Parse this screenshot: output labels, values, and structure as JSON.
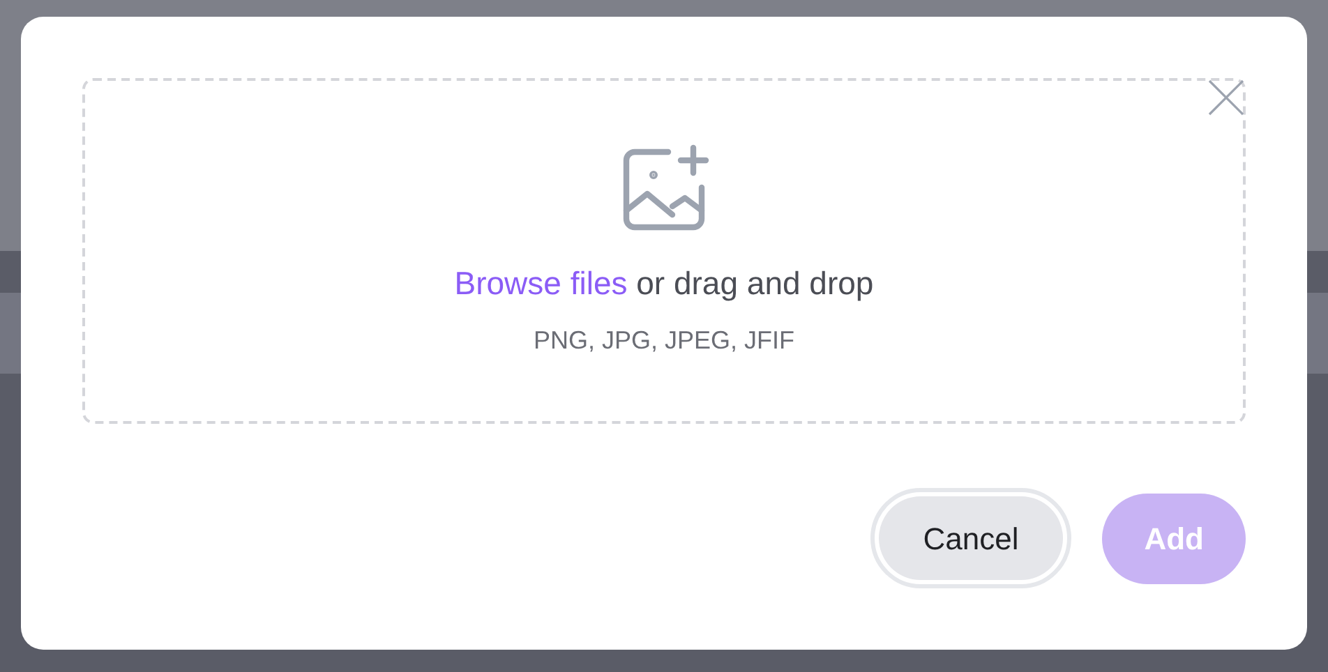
{
  "dialog": {
    "dropzone": {
      "link": "Browse files",
      "text": "or drag and drop",
      "formats": "PNG, JPG, JPEG, JFIF"
    },
    "buttons": [
      {
        "label": "Cancel",
        "kind": "secondary",
        "disabled": false
      },
      {
        "label": "Add",
        "kind": "primary",
        "disabled": true
      }
    ]
  }
}
